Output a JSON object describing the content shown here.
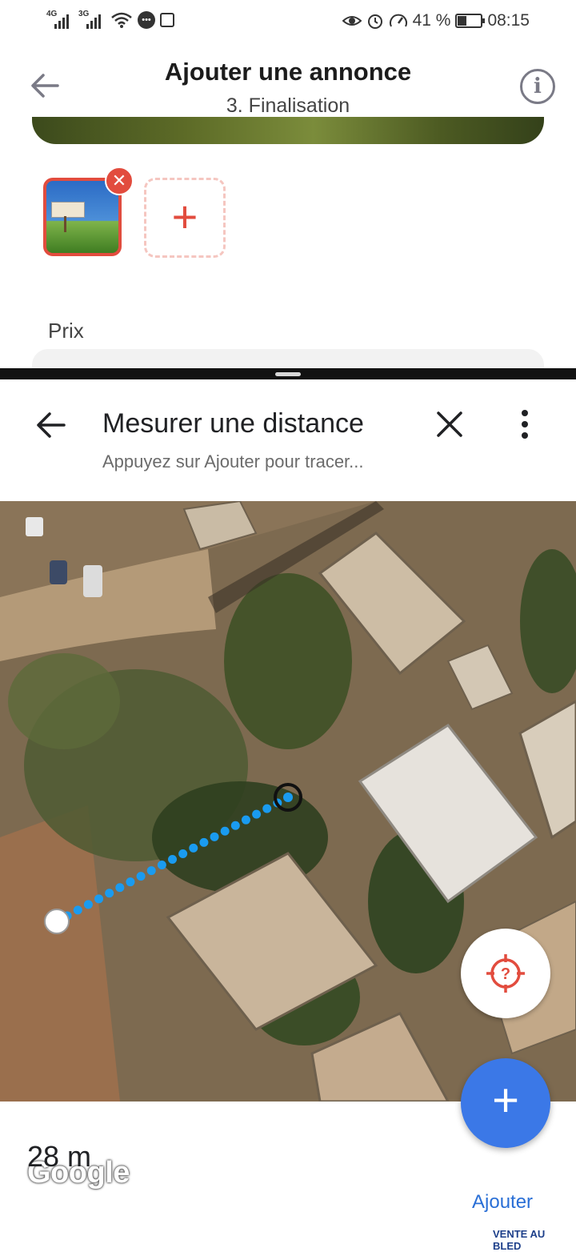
{
  "status_bar": {
    "net1": "4G",
    "net2": "3G",
    "battery": "41 %",
    "battery_level": 0.41,
    "time": "08:15",
    "icons": [
      "signal-icon",
      "wifi-icon",
      "messenger-icon",
      "notification-icon",
      "eye-icon",
      "alarm-icon",
      "speed-icon",
      "battery-icon"
    ]
  },
  "top_app": {
    "title": "Ajouter une annonce",
    "subtitle": "3. Finalisation",
    "price_label": "Prix",
    "add_photo_icon": "+",
    "remove_icon": "✕",
    "info_icon": "i",
    "accent": "#e24c3e"
  },
  "maps": {
    "title": "Mesurer une distance",
    "subtitle": "Appuyez sur Ajouter pour tracer...",
    "google_logo": "Google",
    "distance": "28 m",
    "add_button_label": "Ajouter",
    "add_fab_icon": "+",
    "accent": "#3b78e7",
    "measure_line_color": "#1a9bf0"
  },
  "watermark": "VENTE AU BLED"
}
